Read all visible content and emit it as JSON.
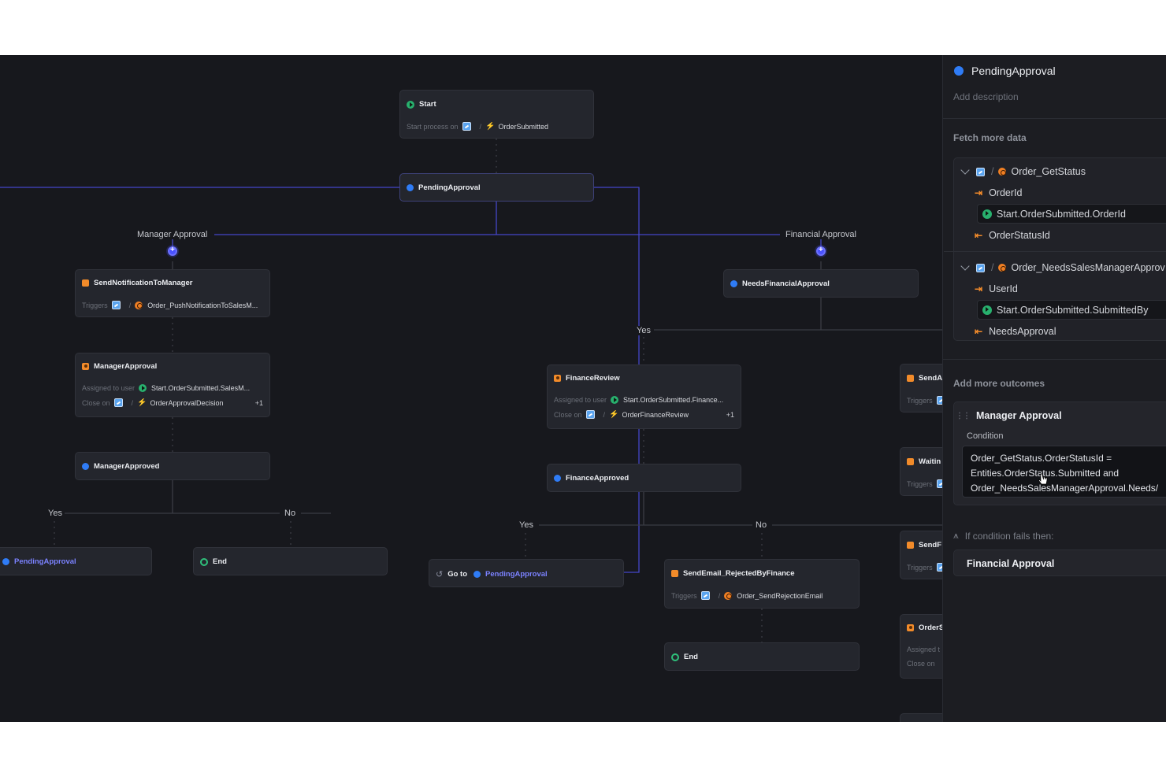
{
  "canvas": {
    "nodes": {
      "start": {
        "title": "Start",
        "label": "Start process on",
        "trigger": "OrderSubmitted"
      },
      "pending_approval": {
        "title": "PendingApproval"
      },
      "send_notification": {
        "title": "SendNotificationToManager",
        "label": "Triggers",
        "service": "Order_PushNotificationToSalesM..."
      },
      "manager_approval": {
        "title": "ManagerApproval",
        "assigned_label": "Assigned to user",
        "assigned_value": "Start.OrderSubmitted.SalesM...",
        "close_label": "Close on",
        "close_value": "OrderApprovalDecision",
        "extra": "+1"
      },
      "manager_approved": {
        "title": "ManagerApproved"
      },
      "pending_left": {
        "title": "PendingApproval"
      },
      "end_left": {
        "title": "End"
      },
      "needs_financial": {
        "title": "NeedsFinancialApproval"
      },
      "finance_review": {
        "title": "FinanceReview",
        "assigned_label": "Assigned to user",
        "assigned_value": "Start.OrderSubmitted.Finance...",
        "close_label": "Close on",
        "close_value": "OrderFinanceReview",
        "extra": "+1"
      },
      "finance_approved": {
        "title": "FinanceApproved"
      },
      "goto": {
        "label": "Go to",
        "target": "PendingApproval"
      },
      "send_rejected": {
        "title": "SendEmail_RejectedByFinance",
        "label": "Triggers",
        "service": "Order_SendRejectionEmail"
      },
      "end_right": {
        "title": "End"
      },
      "cut_send_a": {
        "title": "SendA",
        "label": "Triggers"
      },
      "cut_waiting": {
        "title": "Waitin",
        "label": "Triggers"
      },
      "cut_send_f": {
        "title": "SendF",
        "label": "Triggers"
      },
      "cut_order": {
        "title": "OrderS",
        "label1": "Assigned t",
        "label2": "Close on"
      }
    },
    "edge_labels": {
      "manager_approval": "Manager Approval",
      "financial_approval": "Financial Approval",
      "yes_center": "Yes",
      "yes_left": "Yes",
      "no_left": "No",
      "yes_right": "Yes",
      "no_right": "No"
    }
  },
  "panel": {
    "title": "PendingApproval",
    "description_placeholder": "Add description",
    "fetch_section": "Fetch more data",
    "fetch": [
      {
        "service": "Order_GetStatus",
        "input": "OrderId",
        "input_value": "Start.OrderSubmitted.OrderId",
        "output": "OrderStatusId"
      },
      {
        "service": "Order_NeedsSalesManagerApprov",
        "input": "UserId",
        "input_value": "Start.OrderSubmitted.SubmittedBy",
        "output": "NeedsApproval"
      }
    ],
    "outcomes_section": "Add more outcomes",
    "outcome": {
      "name": "Manager Approval",
      "condition_label": "Condition",
      "condition_lines": [
        "Order_GetStatus.OrderStatusId =",
        "Entities.OrderStatus.Submitted and",
        "Order_NeedsSalesManagerApproval.Needs/"
      ]
    },
    "fails_label": "If condition fails then:",
    "fails_value": "Financial Approval"
  },
  "colors": {
    "canvas_bg": "#17181d",
    "node_bg": "#24262d",
    "edge": "#4f52d6",
    "accent_blue": "#2f7cf6",
    "accent_orange": "#f28b2a",
    "accent_green": "#2fc07b"
  },
  "icons": [
    "play-icon",
    "dot-icon",
    "square-icon",
    "user-task-icon",
    "entity-icon",
    "service-icon",
    "bolt-icon",
    "end-ring-icon",
    "goto-icon",
    "chevron-down-icon",
    "input-icon",
    "output-icon",
    "grip-icon",
    "branch-icon",
    "cursor-icon"
  ]
}
